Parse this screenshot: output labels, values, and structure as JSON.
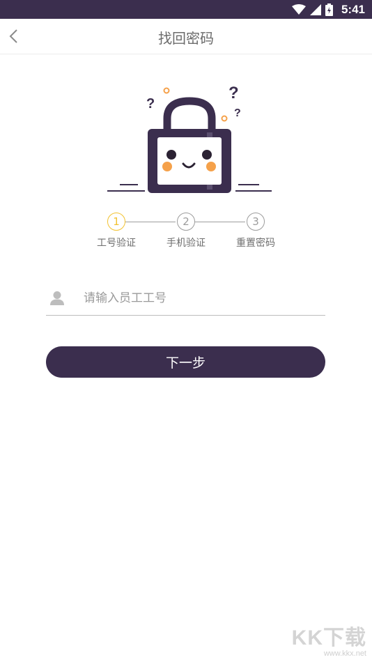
{
  "status_bar": {
    "time": "5:41",
    "icons": [
      "wifi-icon",
      "signal-icon",
      "battery-icon"
    ]
  },
  "header": {
    "title": "找回密码",
    "back_icon": "chevron-left-icon"
  },
  "illustration": {
    "icon": "lock-mascot-illustration"
  },
  "steps": [
    {
      "number": "1",
      "label": "工号验证",
      "active": true
    },
    {
      "number": "2",
      "label": "手机验证",
      "active": false
    },
    {
      "number": "3",
      "label": "重置密码",
      "active": false
    }
  ],
  "form": {
    "employee_id_placeholder": "请输入员工工号",
    "employee_id_value": "",
    "field_icon": "user-icon"
  },
  "actions": {
    "next_label": "下一步"
  },
  "watermark": {
    "logo": "KK下载",
    "url": "www.kkx.net"
  },
  "colors": {
    "primary": "#3b2e4e",
    "active_step": "#f2c230",
    "inactive_step": "#9c9c9c",
    "cheek": "#f5a14a"
  }
}
